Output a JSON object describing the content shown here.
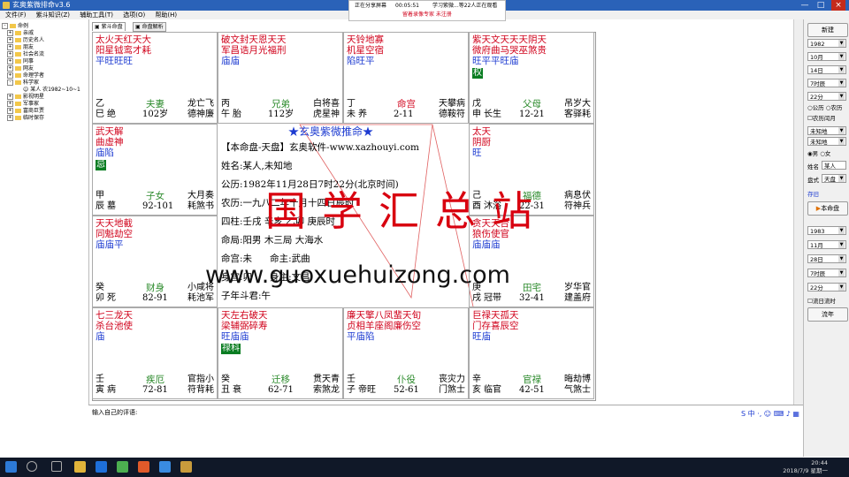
{
  "window": {
    "title": "玄奥紫微排命v3.6",
    "controls": [
      "—",
      "□",
      "×"
    ]
  },
  "menu": [
    "文件(F)",
    "紫斗知识(Z)",
    "辅助工具(T)",
    "选项(O)",
    "帮助(H)"
  ],
  "share_bar": {
    "status": "正在分享屏幕",
    "timer": "00:05:51",
    "viewers": "学习紫微...等22人正在观看",
    "notice": "留着录像专家  未注册"
  },
  "tree": {
    "root": "命例",
    "items": [
      "亲戚",
      "历史名人",
      "朋友",
      "社会名流",
      "同事",
      "网友",
      "命理学者",
      "科学家",
      "某人    农1982~10~1",
      "影视明星",
      "军事家",
      "富商巨贾",
      "临时保存"
    ]
  },
  "tabs": [
    "紫斗命盘",
    "命盘解析"
  ],
  "cells": [
    {
      "id": "si",
      "stars": "太火天红天大",
      "stars2": "阳星钺鸾才耗",
      "bright": "平旺旺旺",
      "hua": "",
      "stem": "乙巳",
      "sheng": "绝",
      "palace": "夫妻",
      "age": "102岁",
      "gods": "龙亡飞\n德神廉",
      "ming": false
    },
    {
      "id": "wu",
      "stars": "破文封天恩天天",
      "stars2": "军昌诰月光福刑",
      "bright": "庙庙",
      "hua": "",
      "stem": "丙午",
      "sheng": "胎",
      "palace": "兄弟",
      "age": "112岁",
      "gods": "白将喜\n虎星神",
      "ming": false
    },
    {
      "id": "wei",
      "stars": "天铃地寡",
      "stars2": "机星空宿",
      "bright": "陷旺平",
      "hua": "",
      "stem": "丁未",
      "sheng": "养",
      "palace": "命宫",
      "age": "2-11",
      "gods": "天攀病\n德鞍符",
      "ming": true
    },
    {
      "id": "shen",
      "stars": "紫天文天天天阴天",
      "stars2": "微府曲马哭巫煞贵",
      "bright": "旺平平旺庙",
      "hua": "权",
      "stem": "戊申",
      "sheng": "长生",
      "palace": "父母",
      "age": "12-21",
      "gods": "吊岁大\n客驿耗",
      "ming": false
    },
    {
      "id": "chen",
      "stars": "武天解",
      "stars2": "曲虚神",
      "bright": "庙陷",
      "hua": "忌",
      "stem": "甲辰",
      "sheng": "墓",
      "palace": "子女",
      "age": "92-101",
      "gods": "大月奏\n耗煞书",
      "ming": false
    },
    {
      "id": "you",
      "stars": "太天",
      "stars2": "阴厨",
      "bright": "旺",
      "hua": "",
      "stem": "己酉",
      "sheng": "沐浴",
      "palace": "福德",
      "age": "22-31",
      "gods": "病息伏\n符神兵",
      "ming": false
    },
    {
      "id": "mao",
      "stars": "天天地截",
      "stars2": "同魁劫空",
      "bright": "庙庙平",
      "hua": "",
      "stem": "癸卯",
      "sheng": "死",
      "palace": "财身",
      "age": "82-91",
      "gods": "小咸将\n耗池军",
      "ming": false
    },
    {
      "id": "xu",
      "stars": "贪天天台",
      "stars2": "狼伤使官",
      "bright": "庙庙庙",
      "hua": "",
      "stem": "庚戌",
      "sheng": "冠带",
      "palace": "田宅",
      "age": "32-41",
      "gods": "岁华官\n建盖府",
      "ming": false
    },
    {
      "id": "yin",
      "stars": "七三龙天",
      "stars2": "杀台池使",
      "bright": "庙",
      "hua": "",
      "stem": "壬寅",
      "sheng": "病",
      "palace": "疾厄",
      "age": "72-81",
      "gods": "官指小\n符背耗",
      "ming": false
    },
    {
      "id": "chou",
      "stars": "天左右破天",
      "stars2": "梁辅弼碎寿",
      "bright": "旺庙庙",
      "hua": "禄科",
      "stem": "癸丑",
      "sheng": "衰",
      "palace": "迁移",
      "age": "62-71",
      "gods": "贯天青\n索煞龙",
      "ming": false
    },
    {
      "id": "zi",
      "stars": "廉天擎八凤蜚天旬",
      "stars2": "贞相羊座阁廉伤空",
      "bright": "平庙陷",
      "hua": "",
      "stem": "壬子",
      "sheng": "帝旺",
      "palace": "仆役",
      "age": "52-61",
      "gods": "丧灾力\n门煞士",
      "ming": false
    },
    {
      "id": "hai",
      "stars": "巨禄天孤天",
      "stars2": "门存喜辰空",
      "bright": "旺庙",
      "hua": "",
      "stem": "辛亥",
      "sheng": "临官",
      "palace": "官禄",
      "age": "42-51",
      "gods": "晦劫博\n气煞士",
      "ming": false
    }
  ],
  "center": {
    "title": "★玄奥紫微推命★",
    "lines": [
      "【本命盘-天盘】玄奥软件-www.xazhouyi.com",
      "姓名:某人,未知地",
      "公历:1982年11月28日7时22分(北京时间)",
      "农历:一九八二年十月十四日辰时",
      "四柱:壬戌 辛亥 乙卯 庚辰时",
      "命局:阳男 木三局 大海水",
      "命宫:未      命主:武曲",
      "身宫:卯      身主:文昌",
      "子年斗君:午"
    ]
  },
  "watermark": {
    "main": "国学汇总站",
    "url": "www.guoxuehuizong.com"
  },
  "comment": {
    "label": "输入自己的评语:"
  },
  "right_panel": {
    "new_button": "新建",
    "year": "1982",
    "month": "10月",
    "day": "14日",
    "hour": "7时辰",
    "minute": "22分",
    "calendar_solar": "公历",
    "calendar_lunar": "农历",
    "leap": "农历闰月",
    "place1": "未知地",
    "place2": "未知地",
    "gender_male": "男",
    "gender_female": "女",
    "name_label": "姓名",
    "name_value": "某人",
    "board_label": "盘式",
    "board_value": "天盘",
    "save_label": "存旧",
    "chart_button": "本命盘",
    "year2": "1983",
    "month2": "11月",
    "day2": "28日",
    "hour2": "7时辰",
    "minute2": "22分",
    "early_zi": "流日流时",
    "flow_button": "流年"
  },
  "taskbar": {
    "time": "20:44",
    "date": "2018/7/9 星期一"
  }
}
